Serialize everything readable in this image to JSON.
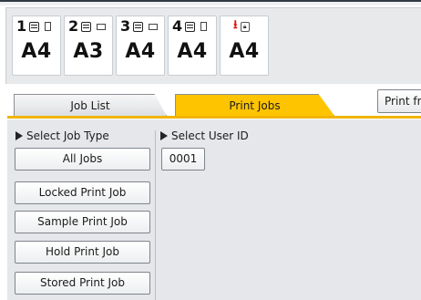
{
  "paper_trays": [
    {
      "number": "1",
      "size": "A4",
      "stack_icon": "paper-stack-icon",
      "orientation_icon": "portrait-paper-icon"
    },
    {
      "number": "2",
      "size": "A3",
      "stack_icon": "paper-stack-icon",
      "orientation_icon": "landscape-paper-icon"
    },
    {
      "number": "3",
      "size": "A4",
      "stack_icon": "paper-stack-icon",
      "orientation_icon": "landscape-paper-icon"
    },
    {
      "number": "4",
      "size": "A4",
      "stack_icon": "paper-stack-icon",
      "orientation_icon": "portrait-paper-icon"
    },
    {
      "number": "",
      "size": "A4",
      "arrow_icon": "bypass-feed-arrow-icon",
      "lock_icon": "locked-tray-icon"
    }
  ],
  "tabs": {
    "job_list": "Job List",
    "print_jobs": "Print Jobs",
    "print_from": "Print fr"
  },
  "colors": {
    "active_tab": "#ffc400",
    "tab_rule": "#f0b400",
    "content_bg": "#e5e7ea",
    "bypass_arrow": "#dd1111"
  },
  "job_type": {
    "label": "Select Job Type",
    "buttons": [
      "All Jobs",
      "Locked Print Job",
      "Sample Print Job",
      "Hold Print Job",
      "Stored Print Job"
    ]
  },
  "user_id": {
    "label": "Select User ID",
    "users": [
      "0001"
    ]
  }
}
